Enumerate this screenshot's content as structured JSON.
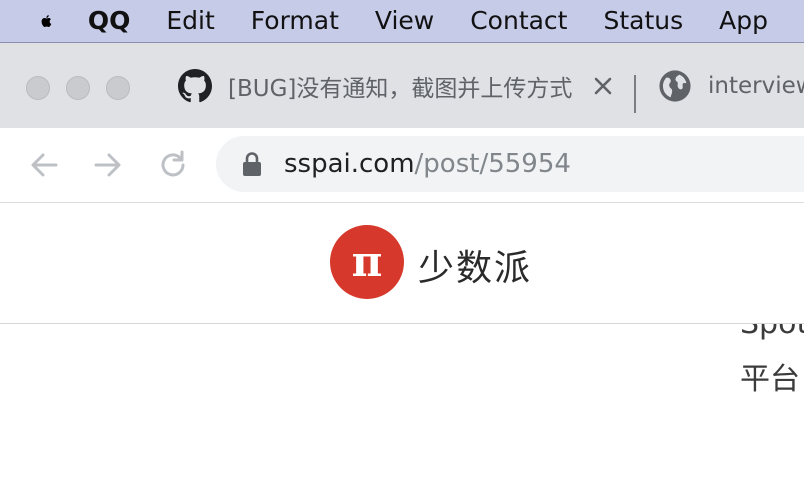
{
  "menubar": {
    "app_name": "QQ",
    "items": [
      "Edit",
      "Format",
      "View",
      "Contact",
      "Status",
      "App"
    ]
  },
  "tabs": {
    "active": {
      "title": "[BUG]没有通知，截图并上传方式",
      "icon": "github-icon"
    },
    "second": {
      "title": "interview",
      "icon": "globe-icon"
    }
  },
  "address_bar": {
    "host": "sspai.com",
    "path": "/post/55954"
  },
  "site": {
    "name": "少数派",
    "logo_glyph": "π",
    "brand_color": "#d6392b"
  },
  "article": {
    "line1": "Spoti",
    "line2": "平台"
  }
}
